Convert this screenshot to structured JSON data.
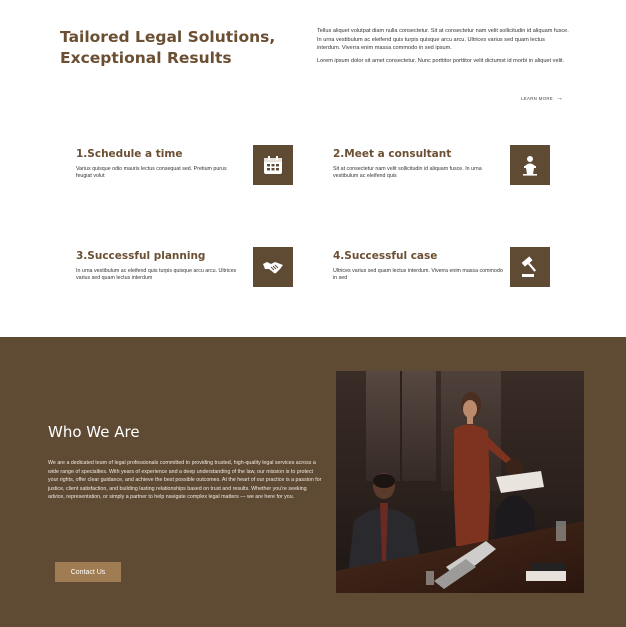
{
  "intro": {
    "title": "Tailored Legal Solutions, Exceptional Results",
    "paragraph_1": "Tellus aliquet volutpat diam nulla consectetur. Sit at consectetur nam velit sollicitudin id aliquam fusce. In urna vestibulum ac eleifend quis turpis quisque arcu arcu. Ultrices varius sed quam lectus interdum. Viverra enim massa commodo in sed ipsum.",
    "paragraph_2": "Lorem ipsum dolor sit amet consectetur. Nunc porttitor porttitor velit dictumst id morbi in aliquet velit.",
    "learn_more": "LEARN MORE",
    "learn_more_arrow": "→"
  },
  "steps": [
    {
      "title": "1.Schedule a time",
      "description": "Varius quisque odio mauris lectus consequat sed. Pretium purus feugiat volut",
      "icon": "calendar-icon"
    },
    {
      "title": "2.Meet a consultant",
      "description": "Sit at consectetur nam velit sollicitudin id aliquam fusce. In urna vestibulum ac eleifend quis",
      "icon": "speaker-podium-icon"
    },
    {
      "title": "3.Successful planning",
      "description": "In urna vestibulum ac eleifend quis turpis quisque arcu arcu. Ultrices varius sed quam lectus interdum",
      "icon": "handshake-icon"
    },
    {
      "title": "4.Successful case",
      "description": "Ultrices varius sed quam lectus interdum. Viverra enim massa commodo in sed",
      "icon": "gavel-icon"
    }
  ],
  "who_we_are": {
    "title": "Who We Are",
    "text": "We are a dedicated team of legal professionals committed to providing trusted, high-quality legal services across a wide range of specialties. With years of experience and a deep understanding of the law, our mission is to protect your rights, offer clear guidance, and achieve the best possible outcomes. At the heart of our practice is a passion for justice, client satisfaction, and building lasting relationships based on trust and results. Whether you're seeking advice, representation, or simply a partner to help navigate complex legal matters — we are here for you.",
    "button_label": "Contact Us"
  },
  "colors": {
    "brand_brown": "#6b4f33",
    "section_bg": "#5f4a33",
    "button_bg": "#a07c52"
  }
}
